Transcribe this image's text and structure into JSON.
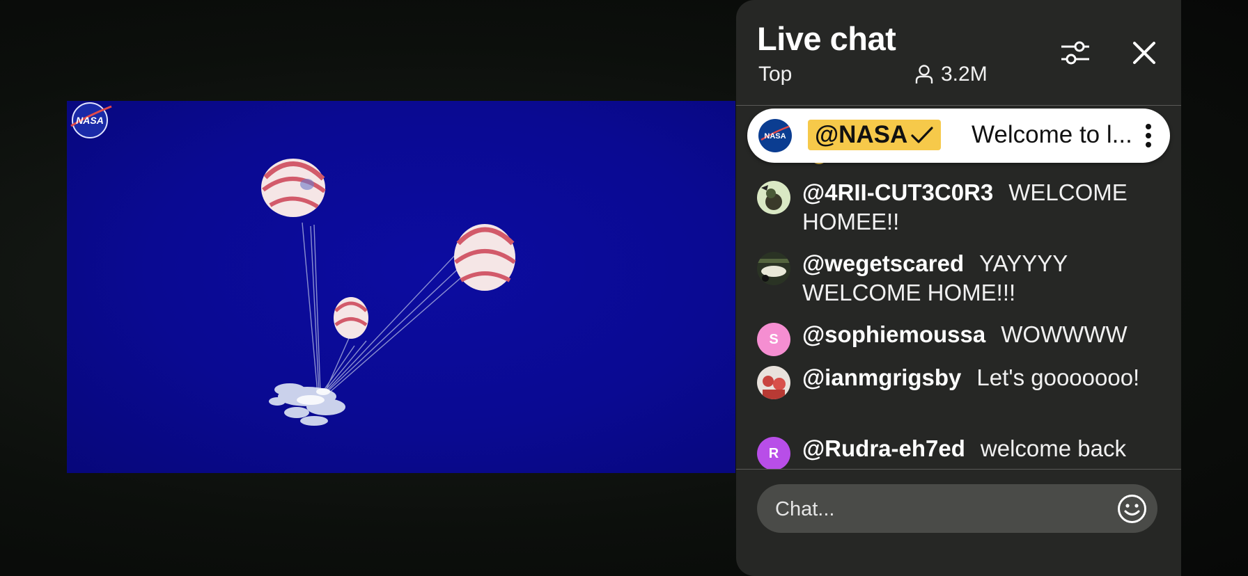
{
  "video": {
    "logo_text": "NASA",
    "background_color": "#0a0a92"
  },
  "chat": {
    "title": "Live chat",
    "mode": "Top",
    "viewer_count": "3.2M",
    "filter_icon": "sliders-icon",
    "close_icon": "close-icon",
    "pinned": {
      "author": "@NASA",
      "verified_icon": "checkmark-icon",
      "text": "Welcome to l...",
      "highlight_color": "#f6c94a"
    },
    "messages": [
      {
        "author": "@4RII-CUT3C0R3",
        "text": "WELCOME HOMEE!!"
      },
      {
        "author": "@wegetscared",
        "text": "YAYYYY WELCOME HOME!!!"
      },
      {
        "author": "@sophiemoussa",
        "text": "WOWWWW",
        "avatar_letter": "S",
        "avatar_color": "#f58ed1"
      },
      {
        "author": "@ianmgrigsby",
        "text": "Let's gooooooo!"
      },
      {
        "author": "@Rudra-eh7ed",
        "text": "welcome back",
        "avatar_letter": "R",
        "avatar_color": "#b84ee8"
      }
    ],
    "input": {
      "placeholder": "Chat...",
      "emoji_icon": "smiley-icon"
    }
  }
}
